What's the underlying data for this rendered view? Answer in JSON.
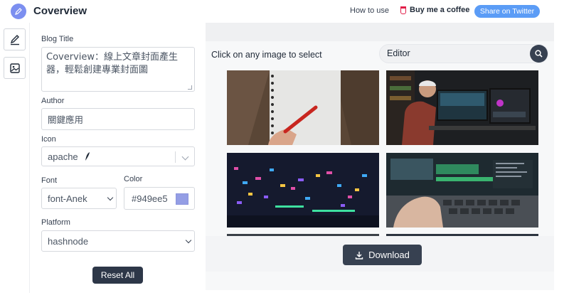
{
  "header": {
    "app_title": "Coverview",
    "how_to_use": "How to use",
    "buy_coffee": "Buy me a coffee",
    "share_twitter": "Share on Twitter"
  },
  "form": {
    "blog_title_label": "Blog Title",
    "blog_title_value": "Coverview：線上文章封面產生器，輕鬆創建專業封面圖",
    "author_label": "Author",
    "author_value": "關鍵應用",
    "icon_label": "Icon",
    "icon_value": "apache",
    "font_label": "Font",
    "font_value": "font-Anek",
    "color_label": "Color",
    "color_value": "#949ee5",
    "platform_label": "Platform",
    "platform_value": "hashnode",
    "reset_label": "Reset All"
  },
  "unsplash": {
    "select_hint": "Click on any image to select",
    "search_value": "Editor",
    "download_label": "Download"
  },
  "colors": {
    "accent": "#949ee5",
    "share_button": "#5b9cf6",
    "dark_button": "#374151"
  },
  "icons": [
    "pen-icon",
    "image-icon",
    "search-icon",
    "download-icon",
    "coffee-icon",
    "feather-icon",
    "chevron-down-icon"
  ]
}
